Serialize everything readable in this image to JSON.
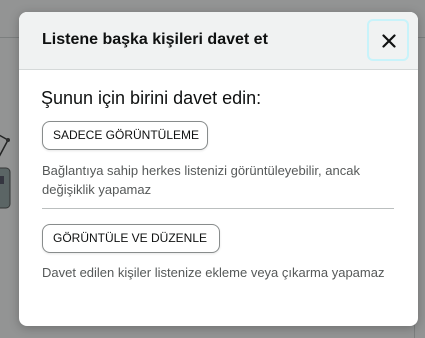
{
  "modal": {
    "title": "Listene başka kişileri davet et",
    "close_icon": "close-icon",
    "heading": "Şunun için birini davet edin:",
    "options": [
      {
        "label": "SADECE GÖRÜNTÜLEME",
        "description": "Bağlantıya sahip herkes listenizi görüntüleyebilir, ancak değişiklik yapamaz"
      },
      {
        "label": "GÖRÜNTÜLE VE DÜZENLE",
        "description": "Davet edilen kişiler listenize ekleme veya çıkarma yapamaz"
      }
    ]
  },
  "colors": {
    "overlay": "#0f1111",
    "header_bg": "#f0f2f2",
    "focus_ring": "#c8f3fa",
    "text_primary": "#0f1111",
    "text_secondary": "#565959"
  }
}
